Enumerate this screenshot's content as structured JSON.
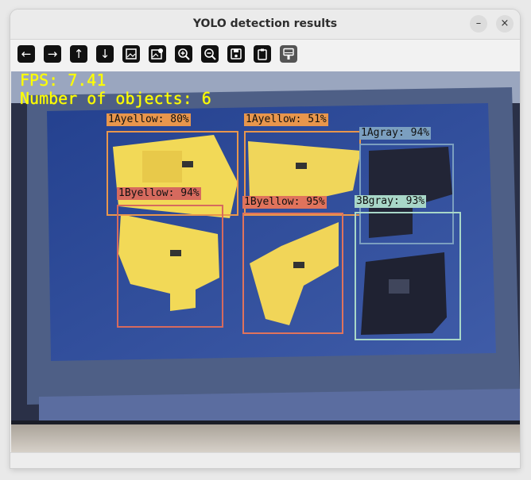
{
  "window": {
    "title": "YOLO detection results",
    "minimize_symbol": "–",
    "close_symbol": "×"
  },
  "toolbar": {
    "buttons": [
      {
        "name": "back-arrow-icon",
        "glyph": "←"
      },
      {
        "name": "forward-arrow-icon",
        "glyph": "→"
      },
      {
        "name": "up-arrow-icon",
        "glyph": "↑"
      },
      {
        "name": "down-arrow-icon",
        "glyph": "↓"
      },
      {
        "name": "image-icon",
        "glyph": ""
      },
      {
        "name": "image-settings-icon",
        "glyph": ""
      },
      {
        "name": "zoom-in-icon",
        "glyph": ""
      },
      {
        "name": "zoom-out-icon",
        "glyph": ""
      },
      {
        "name": "save-icon",
        "glyph": ""
      },
      {
        "name": "clipboard-icon",
        "glyph": ""
      },
      {
        "name": "paint-brush-icon",
        "glyph": ""
      }
    ]
  },
  "overlay": {
    "fps": "FPS: 7.41",
    "count": "Number of objects: 6",
    "text_color": "#ffff00"
  },
  "detections": [
    {
      "label": "1Ayellow: 80%",
      "color": "#e8964c"
    },
    {
      "label": "1Ayellow: 51%",
      "color": "#e8964c"
    },
    {
      "label": "1Agray: 94%",
      "color": "#7b9fc0"
    },
    {
      "label": "1Byellow: 94%",
      "color": "#d66a5e"
    },
    {
      "label": "1Byellow: 95%",
      "color": "#e0735c"
    },
    {
      "label": "3Bgray: 93%",
      "color": "#a8d7c8"
    }
  ]
}
